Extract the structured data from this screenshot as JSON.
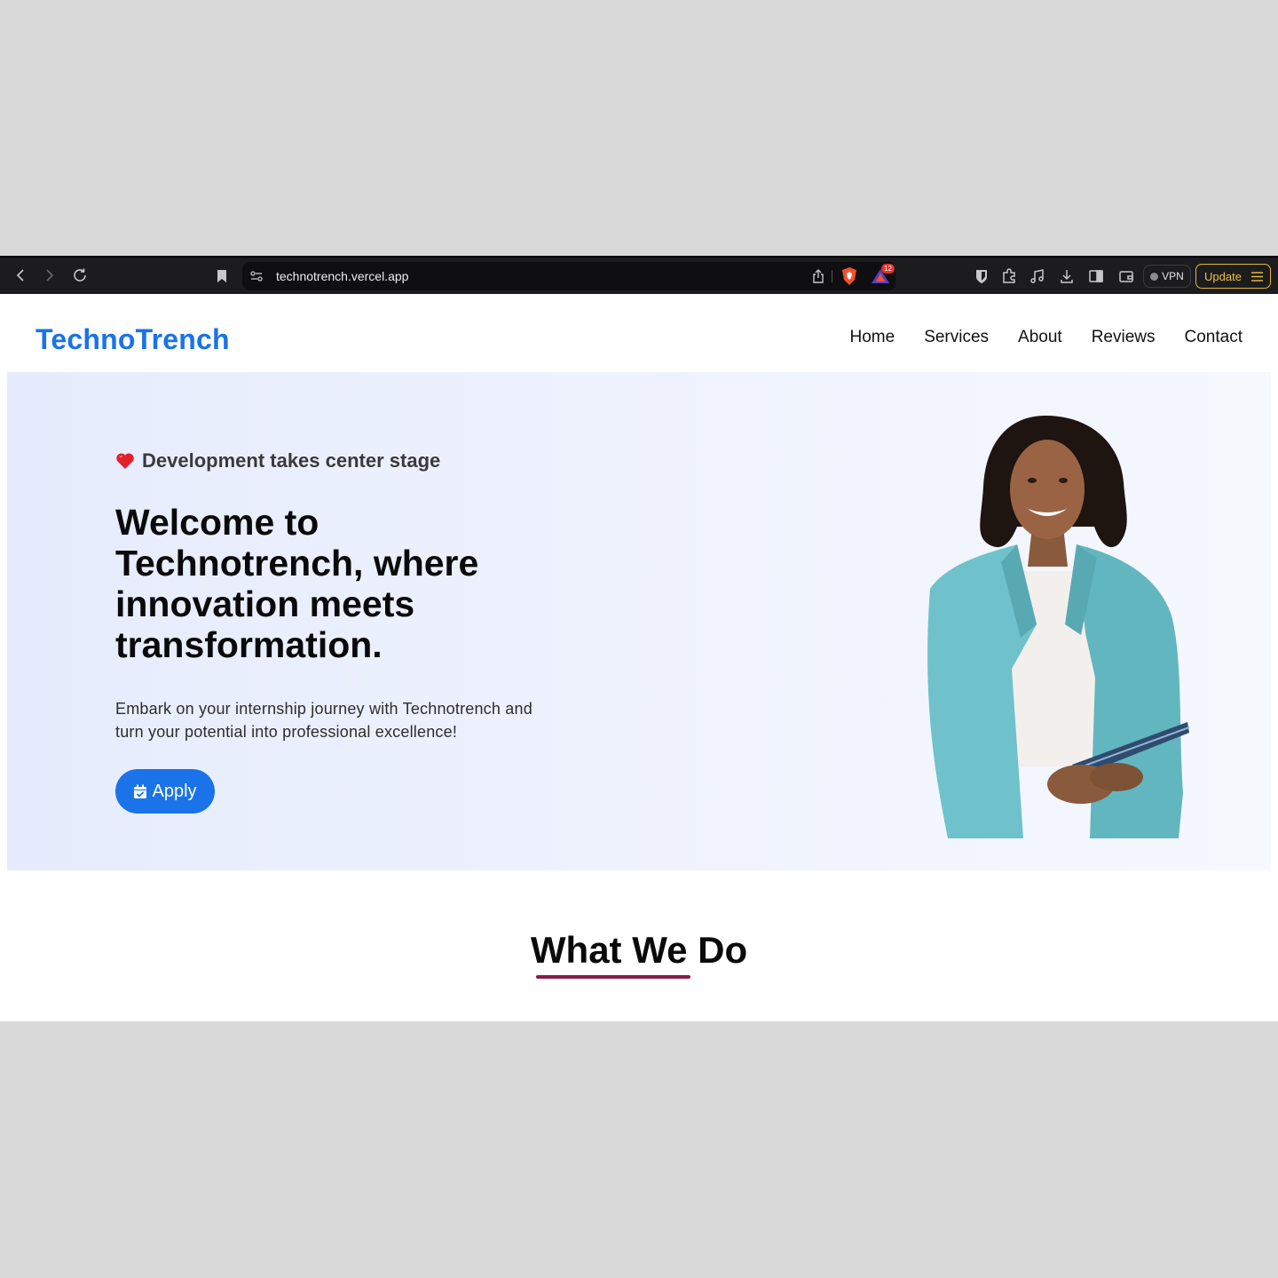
{
  "browser": {
    "url": "technotrench.vercel.app",
    "rewards_badge": "12",
    "vpn_label": "VPN",
    "update_label": "Update"
  },
  "site": {
    "logo": "TechnoTrench",
    "nav": [
      "Home",
      "Services",
      "About",
      "Reviews",
      "Contact"
    ]
  },
  "hero": {
    "tagline": "Development takes center stage",
    "title": "Welcome to Technotrench, where innovation meets transformation.",
    "description": "Embark on your internship journey with Technotrench and turn your potential into professional excellence!",
    "apply_label": "Apply"
  },
  "section": {
    "title": "What We Do"
  },
  "colors": {
    "brand": "#1a73e8",
    "underline": "#8b1a4a",
    "update_border": "#e9b62c"
  }
}
